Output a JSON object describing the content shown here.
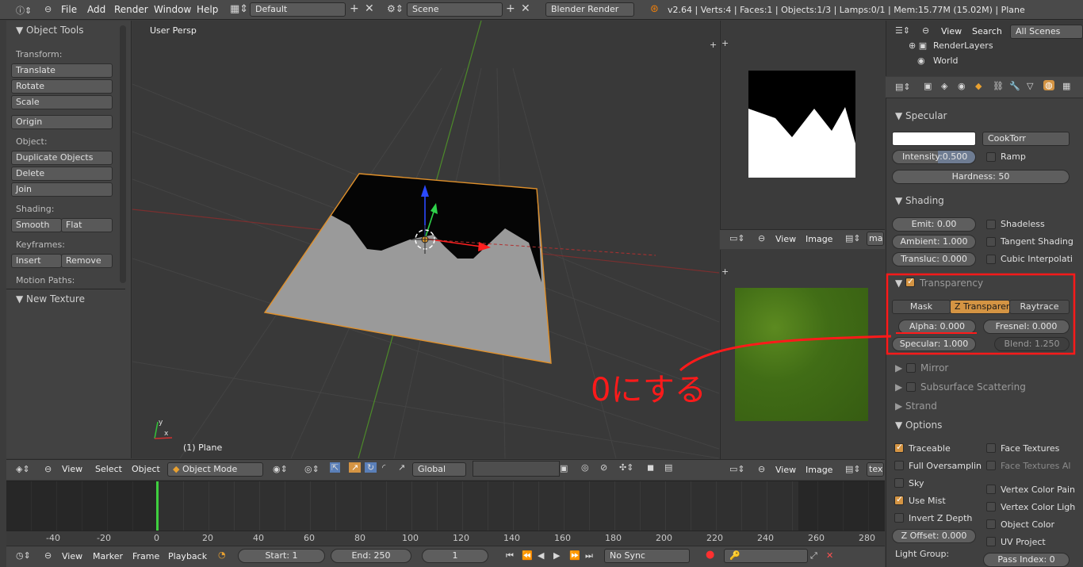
{
  "topbar": {
    "menus": [
      "File",
      "Add",
      "Render",
      "Window",
      "Help"
    ],
    "layout": "Default",
    "scene": "Scene",
    "engine": "Blender Render",
    "stats": "v2.64 | Verts:4 | Faces:1 | Objects:1/3 | Lamps:0/1 | Mem:15.77M (15.02M) | Plane"
  },
  "tools": {
    "title": "Object Tools",
    "transform_label": "Transform:",
    "translate": "Translate",
    "rotate": "Rotate",
    "scale": "Scale",
    "origin": "Origin",
    "object_label": "Object:",
    "duplicate": "Duplicate Objects",
    "delete": "Delete",
    "join": "Join",
    "shading_label": "Shading:",
    "smooth": "Smooth",
    "flat": "Flat",
    "keyframes_label": "Keyframes:",
    "insert": "Insert",
    "remove": "Remove",
    "motion_label": "Motion Paths:",
    "new_texture": "New Texture"
  },
  "viewport": {
    "title": "User Persp",
    "object_label": "(1) Plane",
    "menus": [
      "View",
      "Select",
      "Object"
    ],
    "mode": "Object Mode",
    "orientation": "Global"
  },
  "image_editor": {
    "menus": [
      "View",
      "Image"
    ],
    "image_top": "ma",
    "image_bottom": "tex"
  },
  "annotation": {
    "text": "0にする",
    "color": "#ff1a1a"
  },
  "outliner": {
    "menus": [
      "View",
      "Search"
    ],
    "scope": "All Scenes",
    "items": [
      "RenderLayers",
      "World"
    ]
  },
  "properties": {
    "specular": {
      "title": "Specular",
      "shader": "CookTorr",
      "intensity_label": "Intensity:",
      "intensity": "0.500",
      "ramp": "Ramp",
      "hardness": "Hardness: 50"
    },
    "shading": {
      "title": "Shading",
      "emit": "Emit: 0.00",
      "ambient": "Ambient: 1.000",
      "transluc": "Transluc: 0.000",
      "shadeless": "Shadeless",
      "tangent": "Tangent Shading",
      "cubic": "Cubic Interpolati"
    },
    "transparency": {
      "title": "Transparency",
      "mask": "Mask",
      "ztrans": "Z Transparenc",
      "raytrace": "Raytrace",
      "alpha": "Alpha: 0.000",
      "fresnel": "Fresnel: 0.000",
      "specular": "Specular: 1.000",
      "blend": "Blend: 1.250"
    },
    "mirror": "Mirror",
    "subsurface": "Subsurface Scattering",
    "strand": "Strand",
    "options": {
      "title": "Options",
      "traceable": "Traceable",
      "face_textures": "Face Textures",
      "full_oversampling": "Full Oversamplin",
      "face_textures_alpha": "Face Textures Al",
      "sky": "Sky",
      "vertex_color_paint": "Vertex Color Pain",
      "use_mist": "Use Mist",
      "vertex_color_light": "Vertex Color Ligh",
      "invert_z": "Invert Z Depth",
      "object_color": "Object Color",
      "z_offset": "Z Offset: 0.000",
      "uv_project": "UV Project",
      "light_group": "Light Group:",
      "pass_index": "Pass Index: 0"
    }
  },
  "timeline": {
    "ticks": [
      "-40",
      "-20",
      "0",
      "20",
      "40",
      "60",
      "80",
      "100",
      "120",
      "140",
      "160",
      "180",
      "200",
      "220",
      "240",
      "260",
      "280"
    ],
    "menus": [
      "View",
      "Marker",
      "Frame",
      "Playback"
    ],
    "start": "Start: 1",
    "end": "End: 250",
    "current": "1",
    "sync": "No Sync"
  }
}
